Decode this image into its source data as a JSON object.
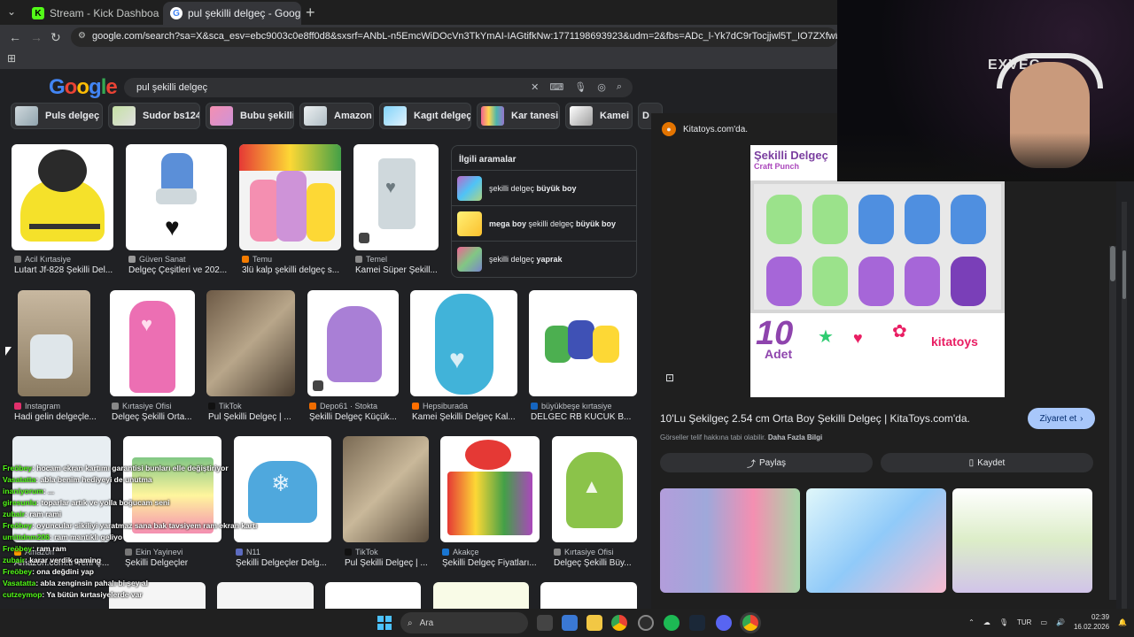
{
  "tabs": [
    {
      "title": "Stream - Kick Dashboard",
      "favicon": "K",
      "active": false
    },
    {
      "title": "pul şekilli delgeç - Google'da A",
      "favicon": "G",
      "active": true
    }
  ],
  "url": "google.com/search?sa=X&sca_esv=ebc9003c0e8ff0d8&sxsrf=ANbL-n5EmcWiDOcVn3TkYmAI-IAGtifkNw:1771198693923&udm=2&fbs=ADc_l-Yk7dC9rTocjjwl5T_IO7ZXfwbLjiNybQex6G113dTgz9R0ZZIPAVc",
  "google": {
    "logo": "Google",
    "query": "pul şekilli delgeç"
  },
  "chips": [
    "Puls delgeç",
    "Sudor bs124",
    "Bubu şekilli",
    "Amazon",
    "Kagıt delgeç",
    "Kar tanesi",
    "Kamei",
    "D"
  ],
  "results_row1": [
    {
      "source": "Acil Kırtasiye",
      "caption": "Lutart Jf-828 Şekilli Del..."
    },
    {
      "source": "Güven Sanat",
      "caption": "Delgeç Çeşitleri ve 202..."
    },
    {
      "source": "Temu",
      "caption": "3lü kalp şekilli delgeç s..."
    },
    {
      "source": "Temel",
      "caption": "Kamei Süper Şekill..."
    }
  ],
  "related": {
    "title": "İlgili aramalar",
    "items": [
      {
        "pre": "şekilli delgeç ",
        "bold": "büyük boy"
      },
      {
        "pre": "mega boy",
        "mid": " şekilli delgeç ",
        "bold": "büyük boy"
      },
      {
        "pre": "şekilli delgeç ",
        "bold": "yaprak"
      }
    ]
  },
  "results_row2": [
    {
      "source": "Instagram",
      "caption": "Hadi gelin delgeçle..."
    },
    {
      "source": "Kırtasiye Ofisi",
      "caption": "Delgeç Şekilli Orta..."
    },
    {
      "source": "TikTok",
      "caption": "Pul Şekilli Delgeç | ..."
    },
    {
      "source": "Depo61 · Stokta",
      "caption": "Şekilli Delgeç Küçük..."
    },
    {
      "source": "Hepsiburada",
      "caption": "Kamei Şekilli Delgeç Kal..."
    },
    {
      "source": "büyükbeşe kırtasiye",
      "caption": "DELGEC RB KUCUK B..."
    }
  ],
  "results_row3": [
    {
      "source": "Amazon",
      "caption": "Amazon.com.tr Yeni Ç..."
    },
    {
      "source": "Ekin Yayinevi",
      "caption": "Şekilli Delgeçler"
    },
    {
      "source": "N11",
      "caption": "Şekilli Delgeçler Delg..."
    },
    {
      "source": "TikTok",
      "caption": "Pul Şekilli Delgeç | ..."
    },
    {
      "source": "Akakçe",
      "caption": "Şekilli Delgeç Fiyatları..."
    },
    {
      "source": "Kırtasiye Ofisi",
      "caption": "Delgeç Şekilli Büy..."
    }
  ],
  "panel": {
    "site": "Kitatoys.com'da.",
    "title": "10'Lu Şekilgeç 2.54 cm Orta Boy Şekilli Delgeç | KitaToys.com'da.",
    "visit": "Ziyaret et",
    "copyright": "Görseller telif hakkına tabi olabilir.",
    "more": "Daha Fazla Bilgi",
    "share": "Paylaş",
    "save": "Kaydet",
    "box_top_text": "Şekilli Delgeç",
    "box_sub": "Craft Punch",
    "box_count": "10",
    "box_count_label": "Adet",
    "box_brand": "kitatoys"
  },
  "webcam": {
    "banner": "EXVEC"
  },
  "chat": [
    {
      "user": "Freöbey",
      "msg": ": hocam ekran kartımı garantisi bunları elle değiştiriyor"
    },
    {
      "user": "Vasatatta",
      "msg": ": abla benim hediyeyi de unutma"
    },
    {
      "user": "inaniyorum",
      "msg": ": ..."
    },
    {
      "user": "giresunlu",
      "msg": ": toparlar artık ve yolla boğucam seni"
    },
    {
      "user": "zubair",
      "msg": ": ram rami"
    },
    {
      "user": "Freöbey",
      "msg": ": oyuncular sikiliyi yaratmaz sana bak tavsiyem ram ekran kartı"
    },
    {
      "user": "umittdnm206",
      "msg": ": ram mantıklı geliyo"
    },
    {
      "user": "Freöbey",
      "msg": ": ram ram"
    },
    {
      "user": "zubair",
      "msg": ": karar verdik gaming"
    },
    {
      "user": "Freöbey",
      "msg": ": ona değdini yap"
    },
    {
      "user": "Vasatatta",
      "msg": ": abla zenginsin pahalı bi şey al"
    },
    {
      "user": "cutzeymop",
      "msg": ": Ya bütün kırtasiyelerde var"
    }
  ],
  "taskbar": {
    "search_placeholder": "Ara",
    "lang": "TUR",
    "time": "02:39",
    "date": "16.02.2026"
  },
  "colors": {
    "page_bg": "#202124",
    "accent": "#a8c7fa",
    "kick_green": "#53fc18"
  }
}
